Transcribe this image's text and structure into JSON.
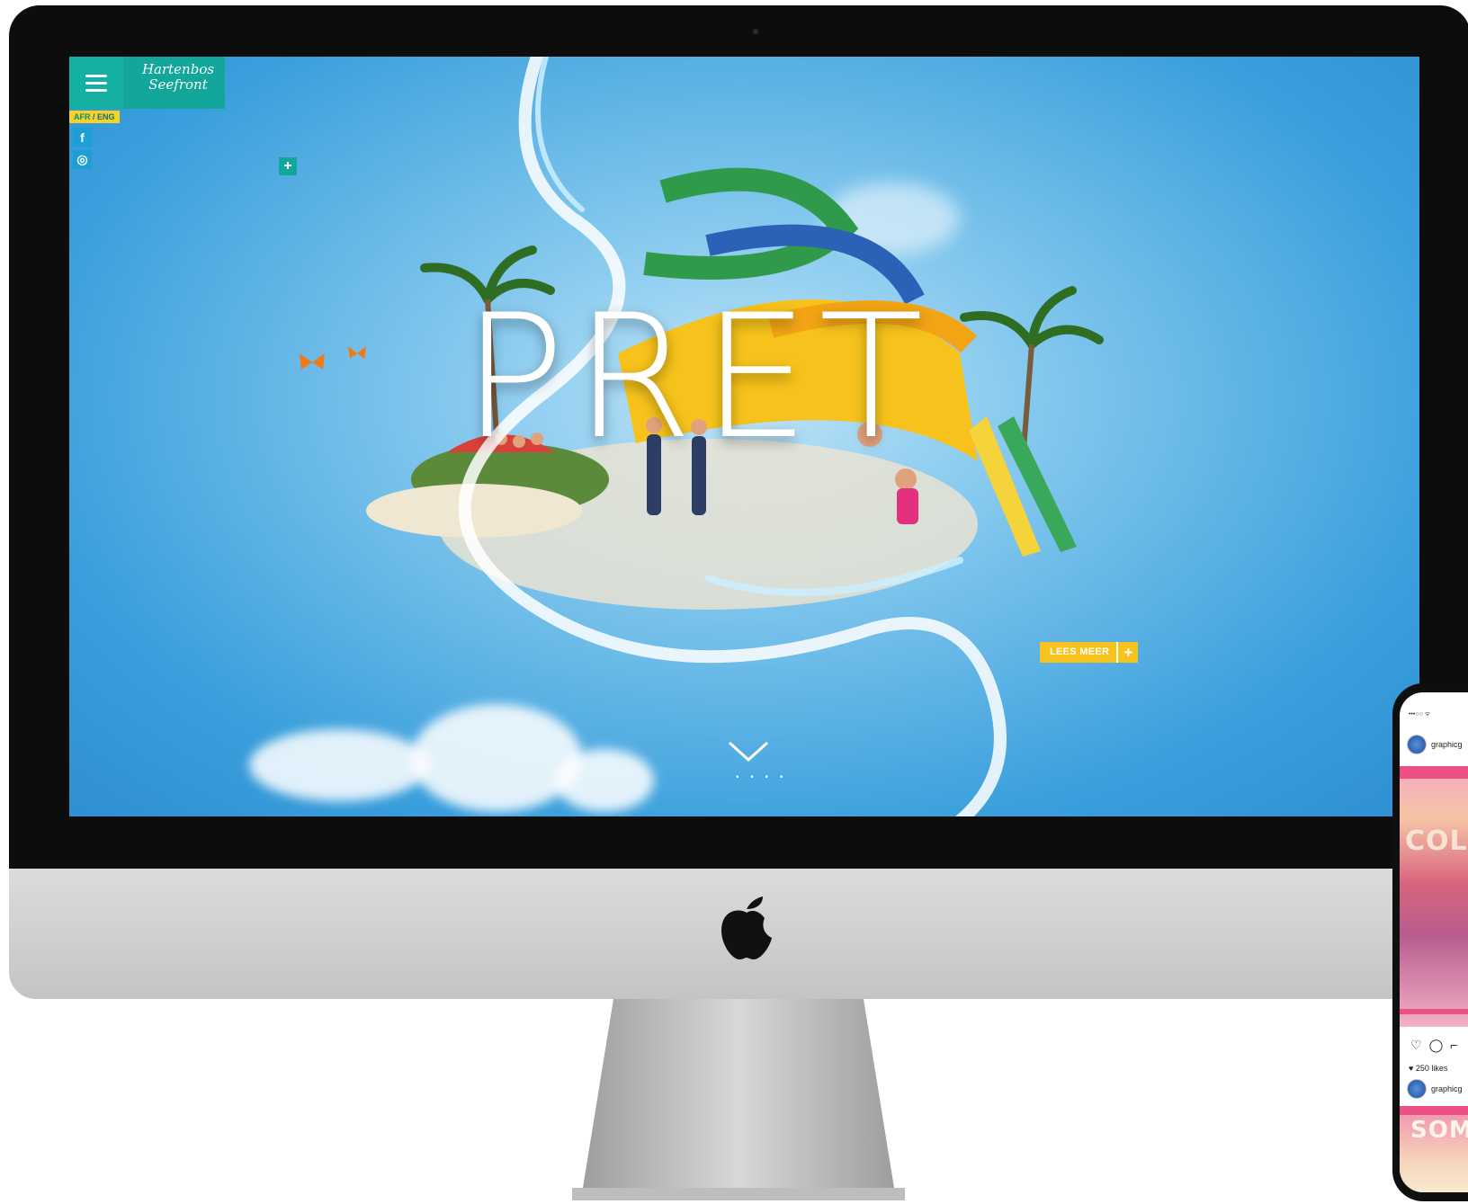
{
  "website": {
    "logo_text": "Hartenbos Seefront",
    "language": {
      "afr": "AFR",
      "separator": "/",
      "eng": "ENG"
    },
    "social": {
      "facebook": "f",
      "instagram": "◎"
    },
    "plus_icon": "+",
    "hero_title": "PRET",
    "cta": {
      "label": "LEES MEER",
      "icon": "+"
    },
    "scroll_dots": "• • • •"
  },
  "phone": {
    "status_bar": "•••○○ ᯤ",
    "username": "graphicg",
    "post_title": "COL",
    "likes": "♥ 250 likes",
    "comment_user": "graphicg",
    "next_post_title": "SOM",
    "action_icons": {
      "like": "♡",
      "comment": "◯",
      "share": "⌐"
    }
  },
  "colors": {
    "teal": "#12a79a",
    "yellow": "#f7c21b",
    "sky_blue": "#3a9fdc",
    "pink": "#ec4f86"
  }
}
